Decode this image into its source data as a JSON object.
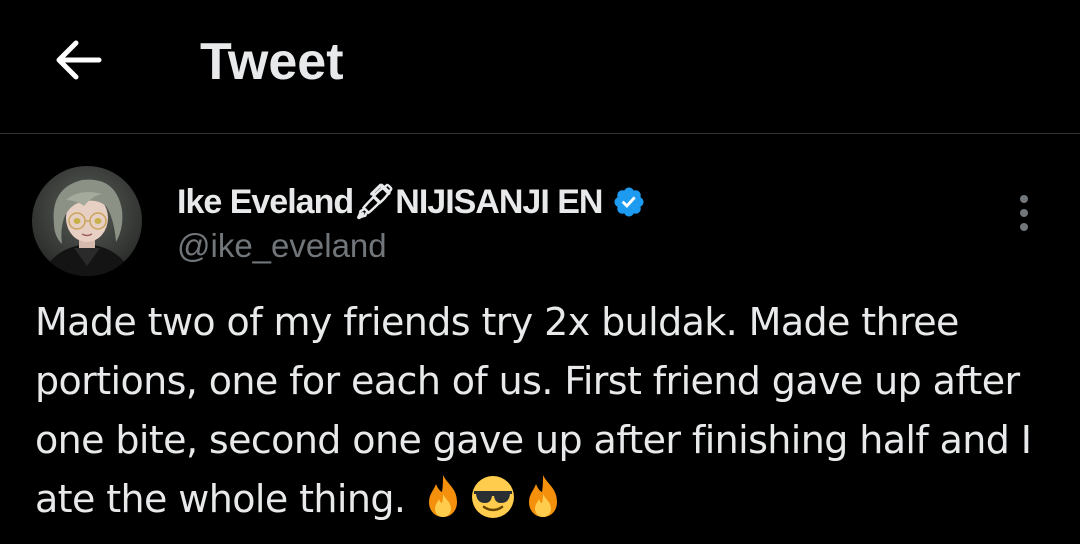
{
  "header": {
    "back_icon": "arrow-left-icon",
    "title": "Tweet"
  },
  "tweet": {
    "author": {
      "name_part1": "Ike Eveland",
      "name_emoji": "🖋",
      "name_part2": "NIJISANJI EN",
      "handle": "@ike_eveland",
      "verified_icon": "verified-badge-icon",
      "verified_color": "#1d9bf0"
    },
    "more_icon": "more-vertical-icon",
    "text": "Made two of my friends try 2x buldak. Made three portions, one for each of us. First friend gave up after one bite, second one gave up after finishing half and I ate the whole thing.",
    "emojis": [
      "fire-emoji",
      "sunglasses-emoji",
      "fire-emoji"
    ]
  },
  "colors": {
    "background": "#000000",
    "primary_text": "#e7e9ea",
    "secondary_text": "#71767b",
    "divider": "#2f3336"
  }
}
